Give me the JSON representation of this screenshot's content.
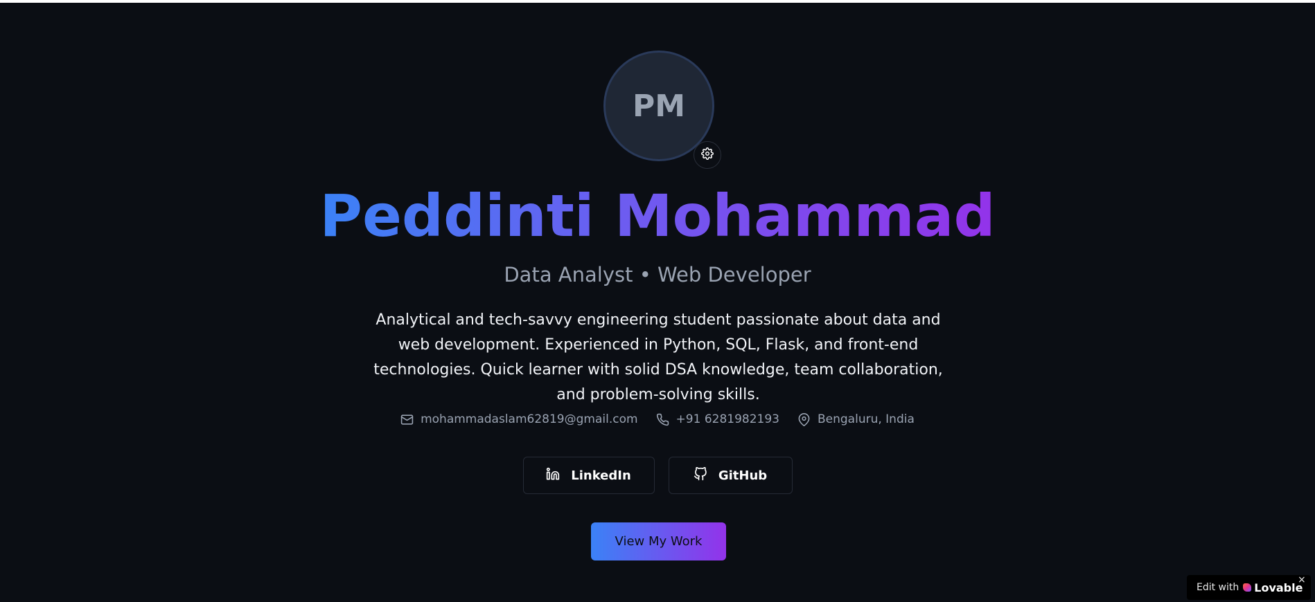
{
  "hero": {
    "initials": "PM",
    "name": "Peddinti Mohammad",
    "roles": "Data Analyst • Web Developer",
    "bio": "Analytical and tech-savvy engineering student passionate about data and web development. Experienced in Python, SQL, Flask, and front-end technologies. Quick learner with solid DSA knowledge, team collaboration, and problem-solving skills."
  },
  "contacts": {
    "email": "mohammadaslam62819@gmail.com",
    "phone": "+91 6281982193",
    "location": "Bengaluru, India"
  },
  "socials": {
    "linkedin_label": "LinkedIn",
    "github_label": "GitHub"
  },
  "cta": {
    "label": "View My Work"
  },
  "badge": {
    "prefix": "Edit with",
    "brand": "Lovable",
    "close": "×"
  },
  "colors": {
    "background": "#0b0e14",
    "gradient_start": "#3b82f6",
    "gradient_end": "#9333ea",
    "muted_text": "#9aa3b2"
  },
  "icons": [
    "gear-icon",
    "mail-icon",
    "phone-icon",
    "map-pin-icon",
    "linkedin-icon",
    "github-icon",
    "lovable-heart-icon",
    "close-icon"
  ]
}
